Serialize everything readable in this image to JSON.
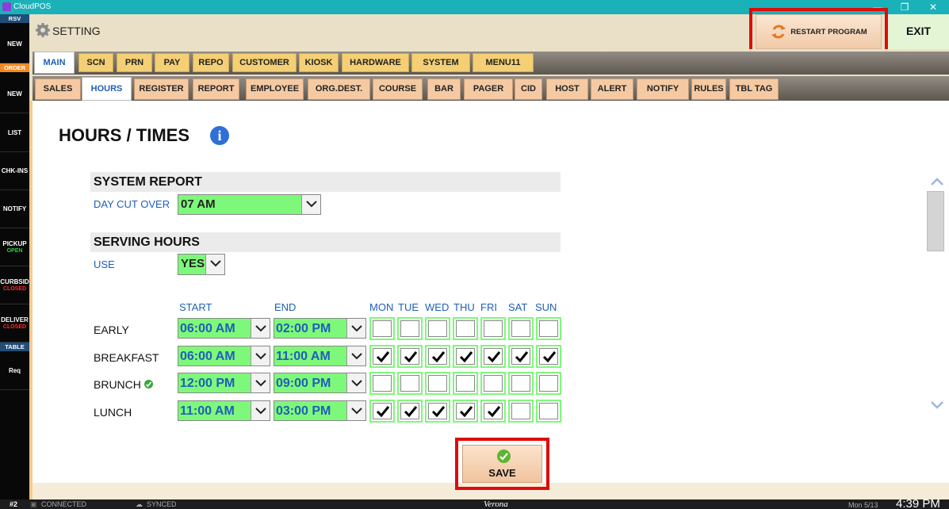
{
  "window": {
    "title": "CloudPOS",
    "minimize": "—",
    "restore": "❐",
    "close": "✕"
  },
  "sidebar": [
    {
      "label": "RSV",
      "kind": "header",
      "bg": "#1f4e79"
    },
    {
      "label": "NEW"
    },
    {
      "label": "ORDER",
      "kind": "header",
      "bg": "#f08a24"
    },
    {
      "label": "NEW"
    },
    {
      "label": "LIST"
    },
    {
      "label": "CHK-INS"
    },
    {
      "label": "NOTIFY"
    },
    {
      "label": "PICKUP",
      "sub": "OPEN",
      "subColor": "#2ecc40"
    },
    {
      "label": "CURBSID",
      "sub": "CLOSED",
      "subColor": "#ff2a2a"
    },
    {
      "label": "DELIVER",
      "sub": "CLOSED",
      "subColor": "#ff2a2a"
    },
    {
      "label": "TABLE",
      "kind": "header",
      "bg": "#1f4e79"
    },
    {
      "label": "Req"
    }
  ],
  "header": {
    "title": "SETTING",
    "restart_label": "RESTART PROGRAM",
    "exit_label": "EXIT"
  },
  "main_tabs": [
    {
      "label": "MAIN",
      "active": true
    },
    {
      "label": "SCN"
    },
    {
      "label": "PRN"
    },
    {
      "label": "PAY"
    },
    {
      "label": "REPO"
    },
    {
      "label": "CUSTOMER"
    },
    {
      "label": "KIOSK"
    },
    {
      "label": "HARDWARE"
    },
    {
      "label": "SYSTEM"
    },
    {
      "label": "MENU11"
    }
  ],
  "sub_tabs": [
    {
      "label": "SALES"
    },
    {
      "label": "HOURS",
      "active": true
    },
    {
      "label": "REGISTER"
    },
    {
      "label": "REPORT"
    },
    {
      "label": "EMPLOYEE"
    },
    {
      "label": "ORG.DEST."
    },
    {
      "label": "COURSE"
    },
    {
      "label": "BAR"
    },
    {
      "label": "PAGER"
    },
    {
      "label": "CID"
    },
    {
      "label": "HOST"
    },
    {
      "label": "ALERT"
    },
    {
      "label": "NOTIFY"
    },
    {
      "label": "RULES"
    },
    {
      "label": "TBL TAG"
    }
  ],
  "page": {
    "title": "HOURS / TIMES",
    "info_icon": "i"
  },
  "system_report": {
    "heading": "SYSTEM REPORT",
    "day_cut_over_label": "DAY CUT OVER",
    "day_cut_over_value": "07 AM"
  },
  "serving_hours": {
    "heading": "SERVING HOURS",
    "use_label": "USE",
    "use_value": "YES",
    "start_label": "START",
    "end_label": "END",
    "days": [
      "MON",
      "TUE",
      "WED",
      "THU",
      "FRI",
      "SAT",
      "SUN"
    ],
    "rows": [
      {
        "name": "EARLY",
        "verified": false,
        "start": "06:00 AM",
        "end": "02:00 PM",
        "days": [
          false,
          false,
          false,
          false,
          false,
          false,
          false
        ]
      },
      {
        "name": "BREAKFAST",
        "verified": false,
        "start": "06:00 AM",
        "end": "11:00 AM",
        "days": [
          true,
          true,
          true,
          true,
          true,
          true,
          true
        ]
      },
      {
        "name": "BRUNCH",
        "verified": true,
        "start": "12:00 PM",
        "end": "09:00 PM",
        "days": [
          false,
          false,
          false,
          false,
          false,
          false,
          false
        ]
      },
      {
        "name": "LUNCH",
        "verified": false,
        "start": "11:00 AM",
        "end": "03:00 PM",
        "days": [
          true,
          true,
          true,
          true,
          true,
          false,
          false
        ]
      }
    ]
  },
  "save_label": "SAVE",
  "status": {
    "terminal": "#2",
    "connected": "CONNECTED",
    "synced": "SYNCED",
    "location": "Verona",
    "date": "Mon 5/13",
    "time": "4:39 PM"
  },
  "colors": {
    "green_field": "#7ef87a",
    "tab_yellow": "#f5cf74",
    "tab_peach": "#f5caa3",
    "highlight_red": "#e00a0a",
    "link_blue": "#1f5fb8"
  }
}
